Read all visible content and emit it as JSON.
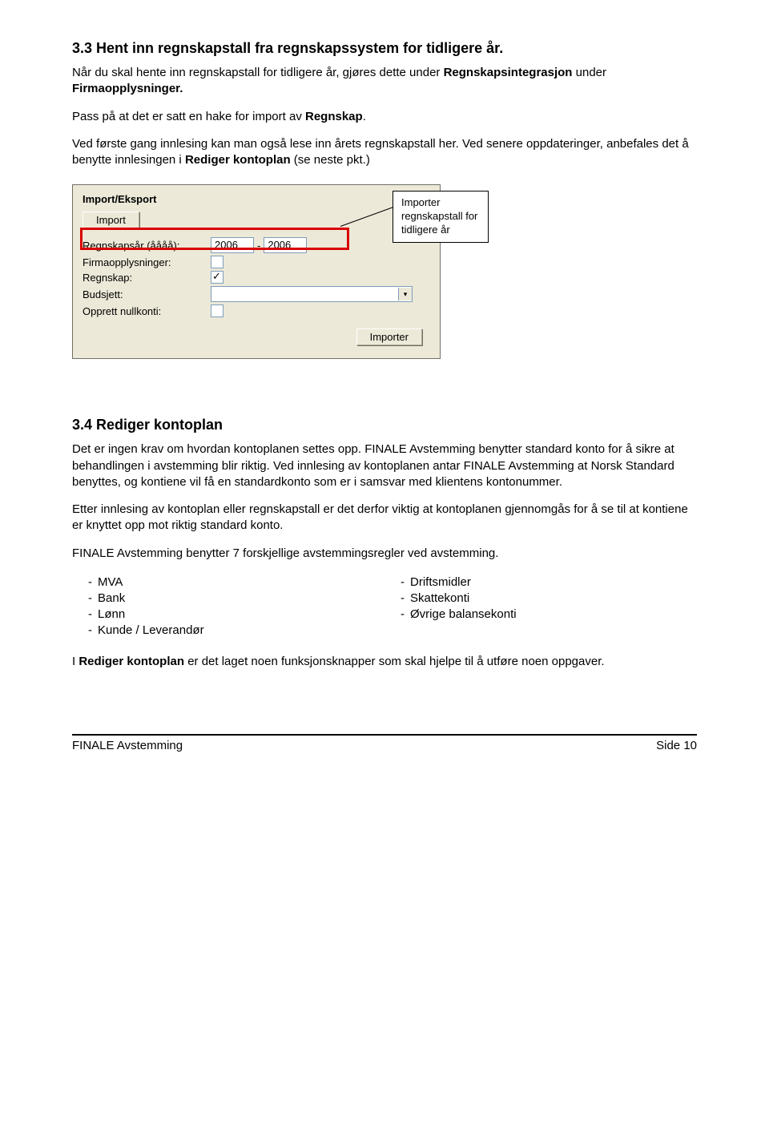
{
  "s33": {
    "heading": "3.3  Hent inn regnskapstall fra regnskapssystem for tidligere år.",
    "p1a": "Når du skal hente inn regnskapstall for tidligere år, gjøres dette under ",
    "p1b": "Regnskapsintegrasjon",
    "p1c": " under ",
    "p1d": "Firmaopplysninger.",
    "p2a": "Pass på at det er satt en hake for import av ",
    "p2b": "Regnskap",
    "p2c": ".",
    "p3a": "Ved første gang innlesing kan man også lese inn årets regnskapstall her.  Ved senere oppdateringer, anbefales det å benytte innlesingen i ",
    "p3b": "Rediger kontoplan",
    "p3c": " (se neste pkt.)"
  },
  "shot": {
    "title": "Import/Eksport",
    "btn_import_top": "Import",
    "r_year": "Regnskapsår (åååå):",
    "year1": "2006",
    "year2": "2006",
    "r_firma": "Firmaopplysninger:",
    "r_regnskap": "Regnskap:",
    "r_budsjett": "Budsjett:",
    "r_nullkonti": "Opprett nullkonti:",
    "btn_importer": "Importer",
    "anno": "Importer regnskapstall for tidligere år"
  },
  "s34": {
    "heading": "3.4  Rediger kontoplan",
    "p1": "Det er ingen krav om hvordan kontoplanen settes opp. FINALE Avstemming benytter standard konto for å sikre at behandlingen i avstemming blir riktig. Ved innlesing av kontoplanen antar FINALE Avstemming at Norsk Standard benyttes, og kontiene vil få en standardkonto som er i samsvar med klientens kontonummer.",
    "p2": "Etter innlesing av kontoplan eller regnskapstall er det derfor viktig at kontoplanen gjennomgås for å se til at kontiene er knyttet opp mot riktig standard konto.",
    "p3": "FINALE Avstemming benytter 7 forskjellige avstemmingsregler ved avstemming."
  },
  "list": {
    "left": [
      "MVA",
      "Bank",
      "Lønn",
      "Kunde / Leverandør"
    ],
    "right": [
      "Driftsmidler",
      "Skattekonti",
      "Øvrige balansekonti"
    ]
  },
  "closing": {
    "a": "I ",
    "b": "Rediger kontoplan",
    "c": " er det laget noen funksjonsknapper som skal hjelpe til å utføre noen oppgaver."
  },
  "footer": {
    "left": "FINALE Avstemming",
    "right": "Side 10"
  }
}
